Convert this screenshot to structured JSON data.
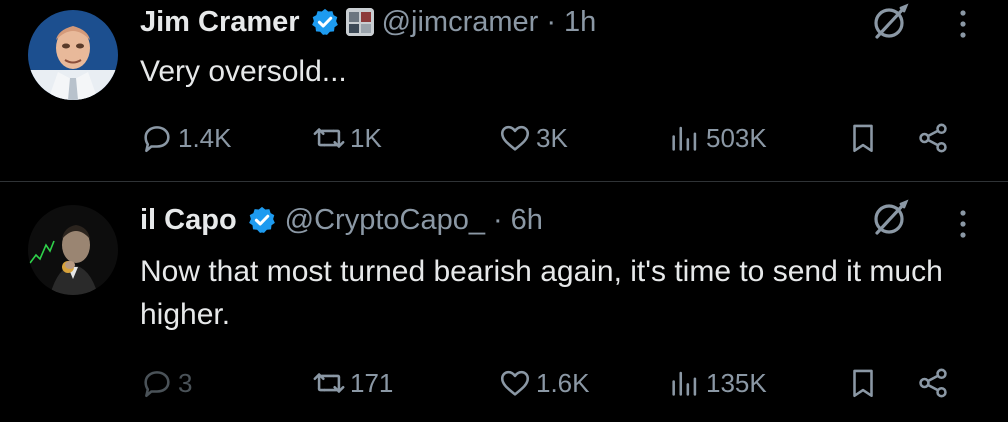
{
  "tweets": [
    {
      "display_name": "Jim Cramer",
      "handle": "@jimcramer",
      "separator": "·",
      "time": "1h",
      "text": "Very oversold...",
      "verified": true,
      "avatar_icon": "avatar-photo-icon",
      "actions": {
        "replies": "1.4K",
        "retweets": "1K",
        "likes": "3K",
        "views": "503K"
      }
    },
    {
      "display_name": "il Capo",
      "handle": "@CryptoCapo_",
      "separator": "·",
      "time": "6h",
      "text": "Now that most turned bearish again, it's time to send it much higher.",
      "verified": true,
      "avatar_icon": "avatar-photo-icon",
      "actions": {
        "replies": "3",
        "retweets": "171",
        "likes": "1.6K",
        "views": "135K"
      }
    }
  ],
  "colors": {
    "background": "#000000",
    "text_primary": "#e7e9ea",
    "text_secondary": "#8b98a5",
    "verified_blue": "#1d9bf0",
    "divider": "#2f3336"
  }
}
